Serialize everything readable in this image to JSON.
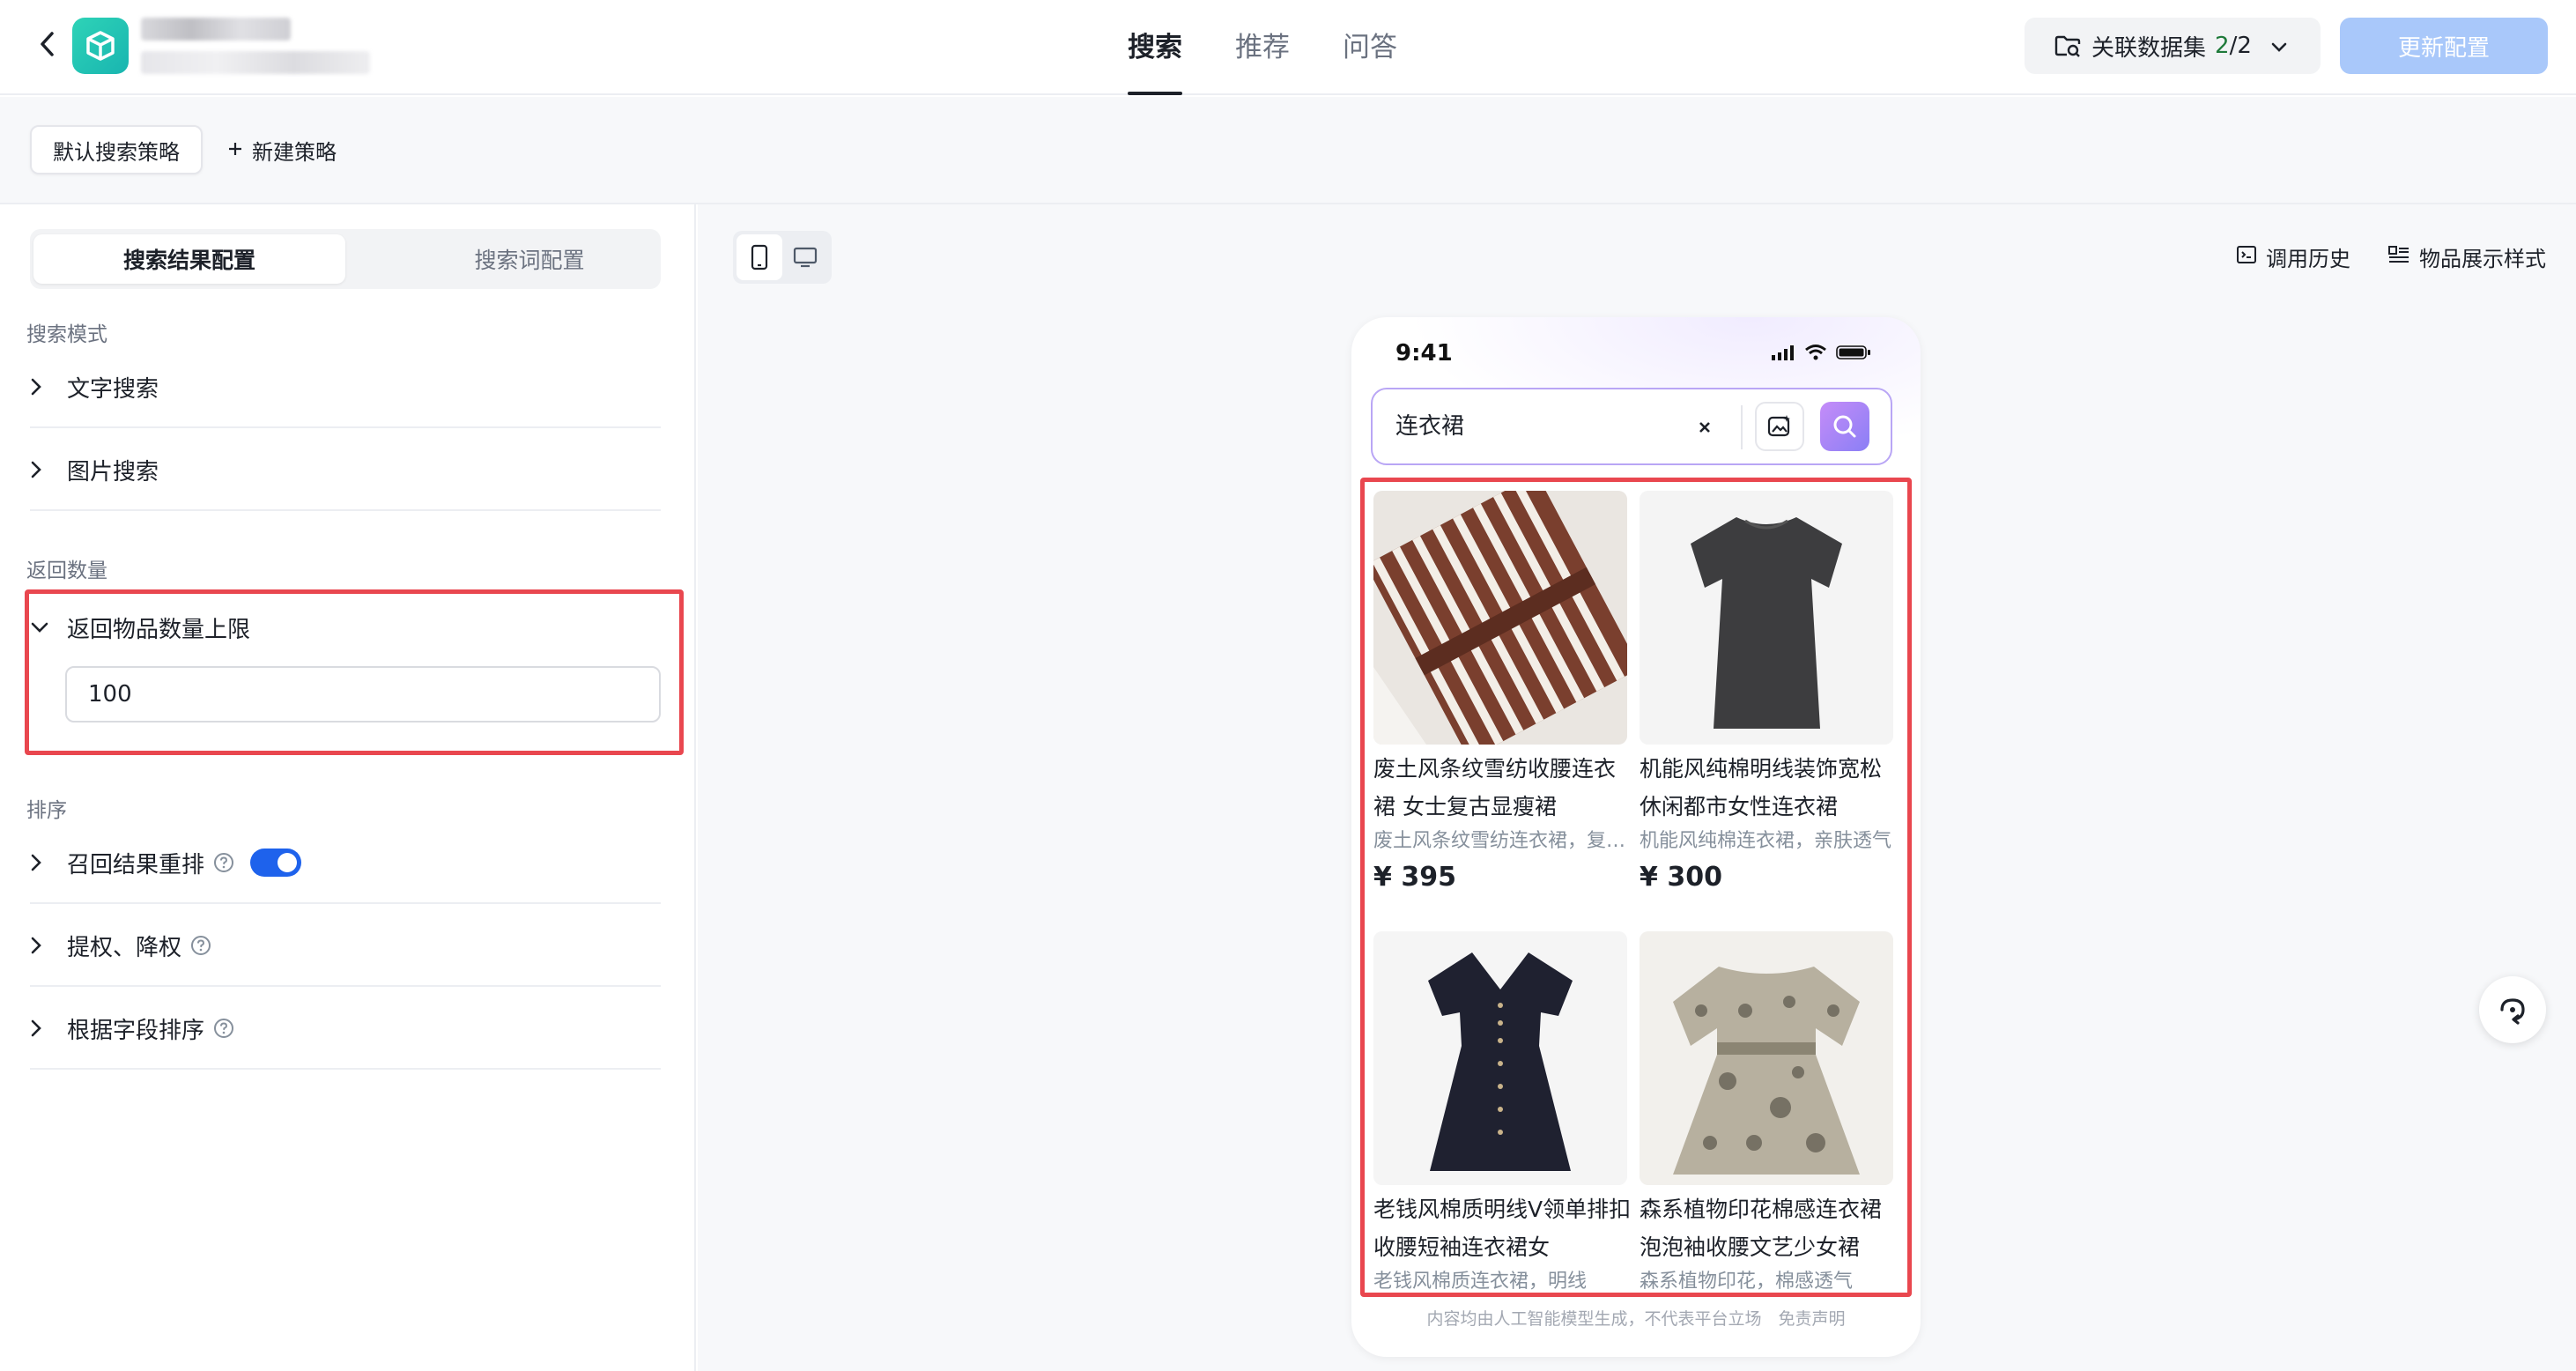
{
  "header": {
    "tabs": [
      {
        "label": "搜索",
        "active": true
      },
      {
        "label": "推荐",
        "active": false
      },
      {
        "label": "问答",
        "active": false
      }
    ],
    "dataset_label": "关联数据集",
    "dataset_count": "2",
    "dataset_total": "/2",
    "update_label": "更新配置"
  },
  "strategy": {
    "default_label": "默认搜索策略",
    "new_label": "新建策略"
  },
  "left": {
    "segment": {
      "active": "搜索结果配置",
      "other": "搜索词配置"
    },
    "search_mode_title": "搜索模式",
    "text_search": "文字搜索",
    "image_search": "图片搜索",
    "return_count_title": "返回数量",
    "return_limit_label": "返回物品数量上限",
    "return_limit_value": "100",
    "sort_title": "排序",
    "rerank_label": "召回结果重排",
    "rerank_enabled": true,
    "boost_label": "提权、降权",
    "field_sort_label": "根据字段排序"
  },
  "main": {
    "history_label": "调用历史",
    "style_label": "物品展示样式"
  },
  "phone": {
    "time": "9:41",
    "query": "连衣裙",
    "disclaimer": "内容均由人工智能模型生成，不代表平台立场　免责声明",
    "items": [
      {
        "title": "废土风条纹雪纺收腰连衣裙 女士复古显瘦裙",
        "desc": "废土风条纹雪纺连衣裙，复古显瘦",
        "price": "¥ 395"
      },
      {
        "title": "机能风纯棉明线装饰宽松休闲都市女性连衣裙",
        "desc": "机能风纯棉连衣裙，亲肤透气",
        "price": "¥ 300"
      },
      {
        "title": "老钱风棉质明线V领单排扣收腰短袖连衣裙女",
        "desc": "老钱风棉质连衣裙，明线",
        "price": ""
      },
      {
        "title": "森系植物印花棉感连衣裙泡泡袖收腰文艺少女裙",
        "desc": "森系植物印花，棉感透气",
        "price": ""
      }
    ]
  },
  "colors": {
    "accent": "#1e62ec",
    "highlight": "#e9474f",
    "update_btn": "#a9c8fa"
  }
}
